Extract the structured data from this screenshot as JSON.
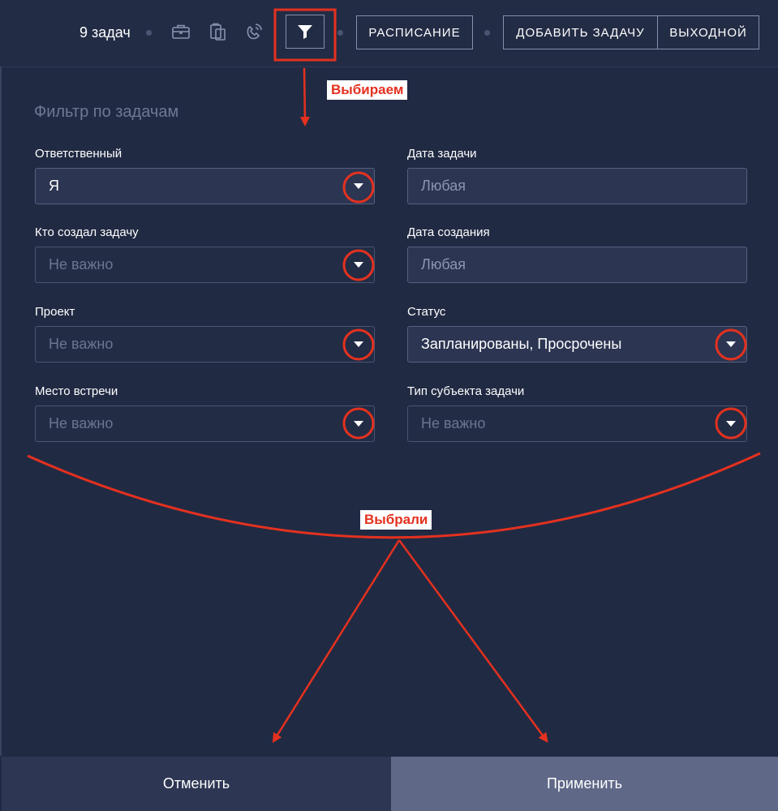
{
  "topbar": {
    "task_count": "9 задач",
    "schedule_label": "РАСПИСАНИЕ",
    "add_task_label": "ДОБАВИТЬ ЗАДАЧУ",
    "day_off_label": "ВЫХОДНОЙ"
  },
  "panel": {
    "title": "Фильтр по задачам",
    "fields": [
      {
        "label": "Ответственный",
        "value": "Я",
        "placeholder": false
      },
      {
        "label": "Дата задачи",
        "value": "Любая",
        "placeholder": false
      },
      {
        "label": "Кто создал задачу",
        "value": "Не важно",
        "placeholder": true
      },
      {
        "label": "Дата создания",
        "value": "Любая",
        "placeholder": false
      },
      {
        "label": "Проект",
        "value": "Не важно",
        "placeholder": true
      },
      {
        "label": "Статус",
        "value": "Запланированы, Просрочены",
        "placeholder": false
      },
      {
        "label": "Место встречи",
        "value": "Не важно",
        "placeholder": true
      },
      {
        "label": "Тип субъекта задачи",
        "value": "Не важно",
        "placeholder": true
      }
    ]
  },
  "footer": {
    "cancel_label": "Отменить",
    "apply_label": "Применить"
  },
  "annotations": {
    "select_label": "Выбираем",
    "selected_label": "Выбрали"
  },
  "colors": {
    "background": "#212a43",
    "annotation_red": "#e4311f",
    "apply_button": "#5f6887"
  }
}
